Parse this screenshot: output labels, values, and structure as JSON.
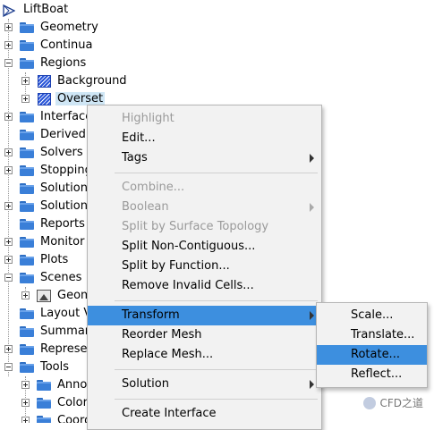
{
  "tree": {
    "root_label": "LiftBoat",
    "items": [
      {
        "label": "Geometry"
      },
      {
        "label": "Continua"
      },
      {
        "label": "Regions"
      },
      {
        "label": "Background"
      },
      {
        "label": "Overset"
      },
      {
        "label": "Interface"
      },
      {
        "label": "Derived"
      },
      {
        "label": "Solvers"
      },
      {
        "label": "Stopping"
      },
      {
        "label": "Solution"
      },
      {
        "label": "Solution"
      },
      {
        "label": "Reports"
      },
      {
        "label": "Monitor"
      },
      {
        "label": "Plots"
      },
      {
        "label": "Scenes"
      },
      {
        "label": "Geom"
      },
      {
        "label": "Layout V"
      },
      {
        "label": "Summar"
      },
      {
        "label": "Represer"
      },
      {
        "label": "Tools"
      },
      {
        "label": "Anno"
      },
      {
        "label": "Color"
      },
      {
        "label": "Coord"
      }
    ]
  },
  "context_menu": {
    "items": [
      {
        "label": "Highlight"
      },
      {
        "label": "Edit..."
      },
      {
        "label": "Tags"
      },
      {
        "label": "Combine..."
      },
      {
        "label": "Boolean"
      },
      {
        "label": "Split by Surface Topology"
      },
      {
        "label": "Split Non-Contiguous..."
      },
      {
        "label": "Split by Function..."
      },
      {
        "label": "Remove Invalid Cells..."
      },
      {
        "label": "Transform"
      },
      {
        "label": "Reorder Mesh"
      },
      {
        "label": "Replace Mesh..."
      },
      {
        "label": "Solution"
      },
      {
        "label": "Create Interface"
      }
    ]
  },
  "transform_submenu": {
    "items": [
      {
        "label": "Scale..."
      },
      {
        "label": "Translate..."
      },
      {
        "label": "Rotate..."
      },
      {
        "label": "Reflect..."
      }
    ]
  },
  "watermark": {
    "text": "CFD之道"
  },
  "colors": {
    "highlight": "#3d8fdf",
    "selection": "#cfe6f5",
    "folder": "#3a7fd8",
    "menu_bg": "#f2f2f2"
  }
}
